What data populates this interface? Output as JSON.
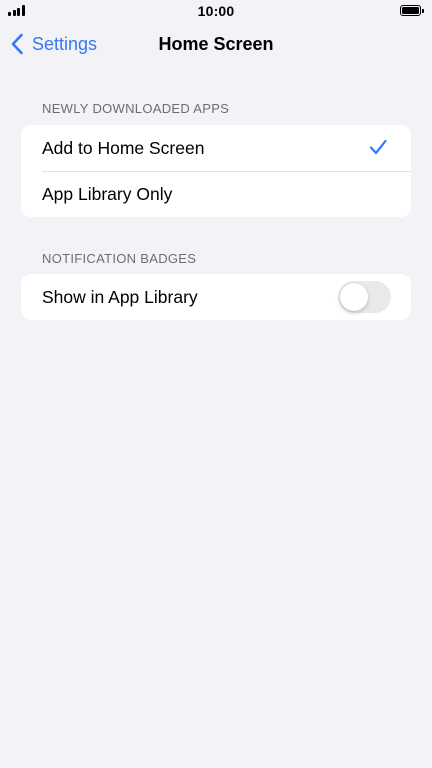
{
  "status_bar": {
    "time": "10:00",
    "signal_icon": "cellular-signal-icon",
    "battery_icon": "battery-full-icon"
  },
  "nav": {
    "back_label": "Settings",
    "back_icon": "chevron-left-icon",
    "title": "Home Screen",
    "accent_color": "#3478f6"
  },
  "sections": {
    "newly_downloaded": {
      "header": "NEWLY DOWNLOADED APPS",
      "options": [
        {
          "label": "Add to Home Screen",
          "selected": true
        },
        {
          "label": "App Library Only",
          "selected": false
        }
      ]
    },
    "notification_badges": {
      "header": "NOTIFICATION BADGES",
      "show_in_app_library": {
        "label": "Show in App Library",
        "enabled": false
      }
    }
  },
  "icons": {
    "selected_check": "checkmark-icon"
  }
}
